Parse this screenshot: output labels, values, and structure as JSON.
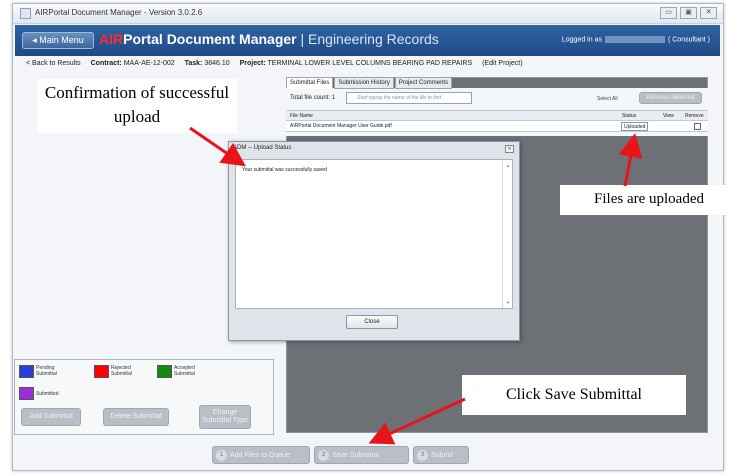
{
  "window": {
    "title": "AIRPortal Document Manager - Version 3.0.2.6",
    "controls": [
      "▭",
      "▣",
      "✕"
    ]
  },
  "header": {
    "main_menu": "◂ Main Menu",
    "title_air": "AIR",
    "title_rest": "Portal Document Manager",
    "title_sep": " | ",
    "title_sub": "Engineering Records",
    "logged_in": "Logged in as",
    "role": "( Consultant )"
  },
  "breadcrumb": {
    "back": "< Back to Results",
    "contract_label": "Contract:",
    "contract": "MAA-AE-12-002",
    "task_label": "Task:",
    "task": "3846.10",
    "project_label": "Project:",
    "project": "TERMINAL LOWER LEVEL COLUMNS BEARING PAD REPAIRS",
    "edit": "(Edit Project)"
  },
  "tabs": [
    "Submittal Files",
    "Submission History",
    "Project Comments"
  ],
  "files": {
    "count_label": "Total file count: 1",
    "search_placeholder": "Start typing the name of the file to find",
    "select_all": "Select All",
    "remove_selected": "Remove Selected",
    "columns": [
      "File Name",
      "Status",
      "View",
      "Remove"
    ],
    "rows": [
      {
        "name": "AIRPortal Document Manager User Guide.pdf",
        "status": "Uploaded"
      }
    ]
  },
  "legend": {
    "items": [
      {
        "label": "Pending Submittal",
        "color": "#2a3fd6"
      },
      {
        "label": "Rejected Submittal",
        "color": "#ff0000"
      },
      {
        "label": "Accepted Submittal",
        "color": "#138a13"
      },
      {
        "label": "Submitted",
        "color": "#9a2fd6"
      }
    ],
    "buttons": [
      "Add Submittal",
      "Delete Submittal",
      "Change Submittal Type"
    ]
  },
  "dialog": {
    "title": "ADM -- Upload Status",
    "message": "Your submittal was successfully saved",
    "close": "Close"
  },
  "actions": [
    {
      "num": "1",
      "label": "Add Files to Queue"
    },
    {
      "num": "2",
      "label": "Save Submittal"
    },
    {
      "num": "3",
      "label": "Submit"
    }
  ],
  "callouts": {
    "confirm": "Confirmation of successful upload",
    "uploaded": "Files are uploaded",
    "save": "Click Save Submittal"
  },
  "colors": {
    "header": "#2f63a3",
    "air_red": "#ff2a2a",
    "arrow": "#e8141a",
    "disabled_button": "#b9bfc7"
  }
}
